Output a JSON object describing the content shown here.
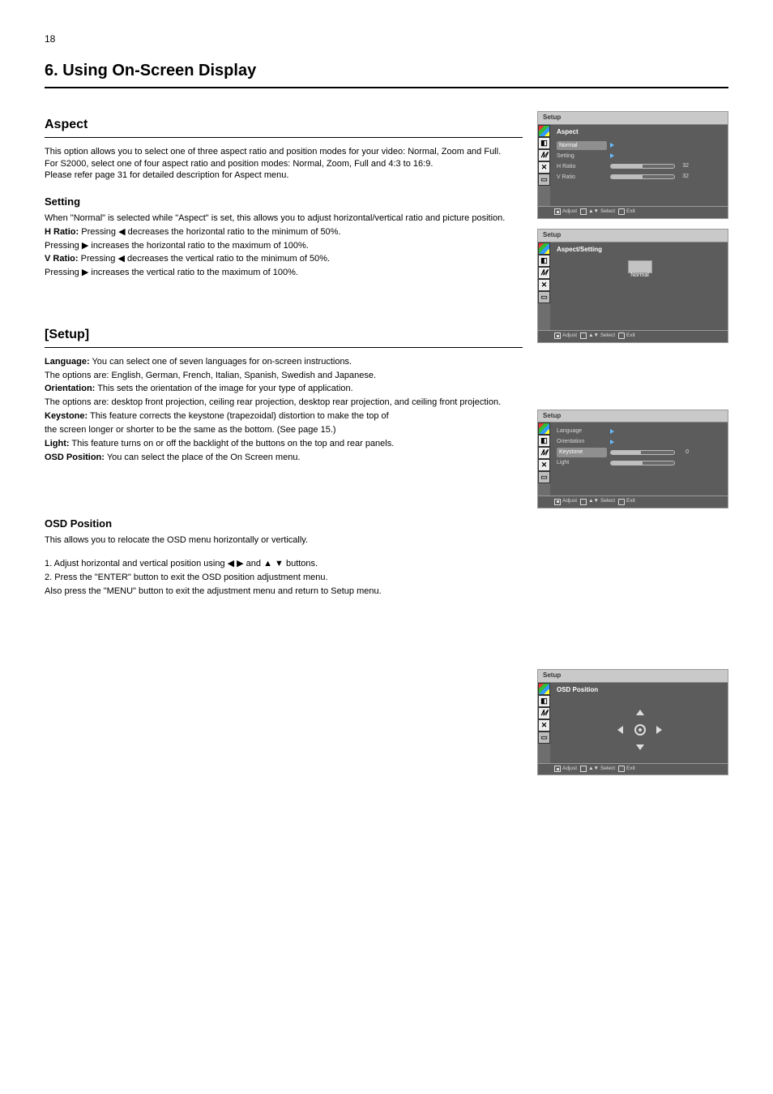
{
  "page_number": "18",
  "page_title": "6. Using On-Screen Display",
  "section_aspect": {
    "heading": "Aspect",
    "summary_pre": "This option allows you to select one of three aspect ratio and position modes for your video: ",
    "summary_opts": "Normal, Zoom and Full.",
    "summary_post_1": "For S2000, select one of four aspect ratio and position modes: Normal, Zoom, Full and 4:3 to 16:9.",
    "summary_post_2": "Please refer page 31 for detailed description for Aspect menu.",
    "sub_heading": "Setting",
    "lines": [
      {
        "t": "",
        "pre": "When \"Normal\" is selected while \"Aspect\" is set, this allows you to adjust horizontal/vertical ratio and picture position."
      },
      {
        "t": "H Ratio:",
        "body": "Pressing ◀ decreases the horizontal ratio to the minimum of 50%."
      },
      {
        "t": "",
        "body": "Pressing ▶ increases the horizontal ratio to the maximum of 100%."
      },
      {
        "t": "V Ratio:",
        "body": "Pressing ◀ decreases the vertical ratio to the minimum of 50%."
      },
      {
        "t": "",
        "body": "Pressing ▶ increases the vertical ratio to the maximum of 100%."
      }
    ]
  },
  "section_setup": {
    "heading": "[Setup]",
    "lines": [
      {
        "t": "Language:",
        "body": "You can select one of seven languages for on-screen instructions."
      },
      {
        "t": "",
        "body": "The options are: English, German, French, Italian, Spanish, Swedish and Japanese."
      },
      {
        "t": "Orientation:",
        "body": "This sets the orientation of the image for your type of application."
      },
      {
        "t": "",
        "body": "The options are: desktop front projection, ceiling rear projection, desktop rear projection, and ceiling front projection."
      },
      {
        "t": "Keystone:",
        "body": "This feature corrects the keystone (trapezoidal) distortion to make the top of"
      },
      {
        "t": "",
        "body": "the screen longer or shorter to be the same as the bottom. (See page 15.)"
      },
      {
        "t": "Light:",
        "body": "This feature turns on or off the backlight of the buttons on the top and rear panels."
      },
      {
        "t": "OSD Position:",
        "body": "You can select the place of the On Screen menu."
      }
    ],
    "osd_heading": "OSD Position",
    "osd_intro": "This allows you to relocate the OSD menu horizontally or vertically.",
    "osd_steps": [
      "1. Adjust horizontal and vertical position using ◀ ▶ and ▲ ▼ buttons.",
      "2. Press the \"ENTER\" button to exit the OSD position adjustment menu.",
      "Also press the \"MENU\" button to exit the adjustment menu and return to Setup menu."
    ]
  },
  "osd_common": {
    "footer_adjust": "Adjust",
    "footer_select": "Select",
    "footer_exit": "Exit",
    "select_hint": "▲▼"
  },
  "panel_aspect": {
    "top": "Setup",
    "title": "Aspect",
    "rows": [
      {
        "label": "Normal",
        "type": "arrow"
      },
      {
        "label": "Setting",
        "type": "arrow"
      },
      {
        "label": "H Ratio",
        "type": "slider",
        "fill": 50,
        "num": "32"
      },
      {
        "label": "V Ratio",
        "type": "slider",
        "fill": 50,
        "num": "32"
      }
    ]
  },
  "panel_setting": {
    "top": "Setup",
    "title": "Aspect/Setting",
    "mode": "Normal"
  },
  "panel_setup": {
    "top": "Setup",
    "rows": [
      {
        "label": "Language",
        "type": "arrow"
      },
      {
        "label": "Orientation",
        "type": "arrow"
      },
      {
        "label": "Keystone",
        "type": "slider",
        "fill": 48,
        "num": "0"
      },
      {
        "label": "Light",
        "type": "slider",
        "fill": 50,
        "num": ""
      }
    ]
  },
  "panel_osdpos": {
    "top": "Setup",
    "title": "OSD Position"
  }
}
